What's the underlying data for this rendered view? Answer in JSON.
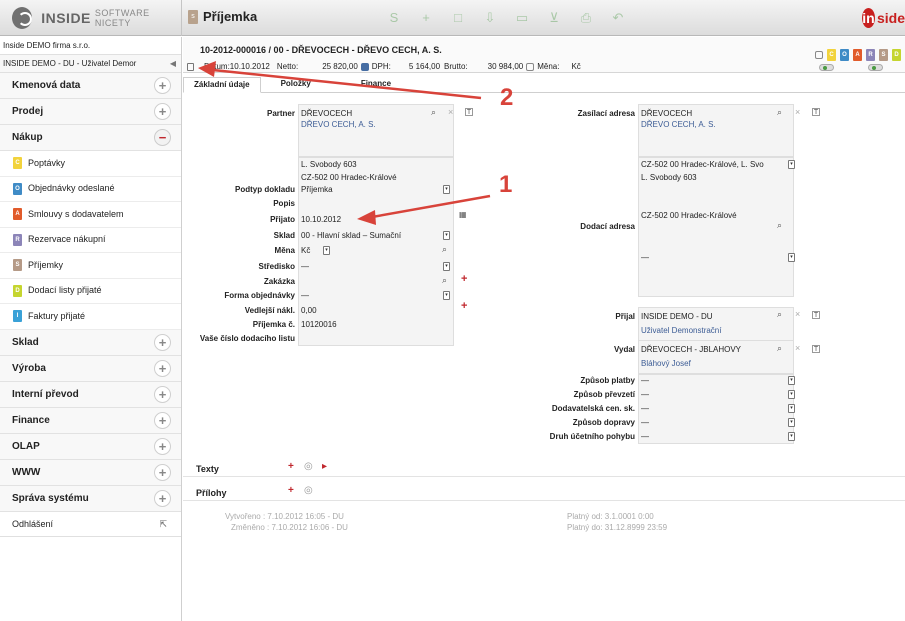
{
  "app": {
    "logo_strong": "INSIDE",
    "logo_light": "SOFTWARE NICETY",
    "brand_text": "side",
    "brand_letter": "in"
  },
  "module": {
    "badge": "s",
    "title": "Příjemka"
  },
  "toolbar": [
    "S",
    "+",
    "□",
    "⇩",
    "▭",
    "⊻",
    "⎙",
    "↶"
  ],
  "sidebar": {
    "firm": "Inside DEMO firma s.r.o.",
    "user": "INSIDE DEMO - DU - Uživatel Demor",
    "groups": [
      {
        "label": "Kmenová data",
        "state": "+"
      },
      {
        "label": "Prodej",
        "state": "+"
      },
      {
        "label": "Nákup",
        "state": "−"
      }
    ],
    "nakup_items": [
      {
        "badge": "C",
        "label": "Poptávky",
        "color": "#f2d33c"
      },
      {
        "badge": "O",
        "label": "Objednávky odeslané",
        "color": "#3f8bc6"
      },
      {
        "badge": "A",
        "label": "Smlouvy s dodavatelem",
        "color": "#e15b2b"
      },
      {
        "badge": "R",
        "label": "Rezervace nákupní",
        "color": "#8c85b8"
      },
      {
        "badge": "S",
        "label": "Příjemky",
        "color": "#b59a87"
      },
      {
        "badge": "D",
        "label": "Dodací listy přijaté",
        "color": "#c5d52f"
      },
      {
        "badge": "I",
        "label": "Faktury přijaté",
        "color": "#3aa1d7"
      }
    ],
    "groups_after": [
      {
        "label": "Sklad",
        "state": "+"
      },
      {
        "label": "Výroba",
        "state": "+"
      },
      {
        "label": "Interní převod",
        "state": "+"
      },
      {
        "label": "Finance",
        "state": "+"
      },
      {
        "label": "OLAP",
        "state": "+"
      },
      {
        "label": "WWW",
        "state": "+"
      },
      {
        "label": "Správa systému",
        "state": "+"
      }
    ],
    "logout": "Odhlášení"
  },
  "document": {
    "number": "10-2012-000016 / 00 - DŘEVOCECH - DŘEVO CECH, A. S.",
    "datum_label": "Datum:",
    "datum": "10.10.2012",
    "netto_label": "Netto:",
    "netto": "25 820,00",
    "dph_label": "DPH:",
    "dph": "5 164,00",
    "brutto_label": "Brutto:",
    "brutto": "30 984,00",
    "mena_label": "Měna:",
    "mena": "Kč"
  },
  "status_icons": [
    {
      "badge": "C",
      "color": "#f2d33c"
    },
    {
      "badge": "O",
      "color": "#3f8bc6"
    },
    {
      "badge": "A",
      "color": "#e15b2b"
    },
    {
      "badge": "R",
      "color": "#8c85b8"
    },
    {
      "badge": "S",
      "color": "#b59a87"
    },
    {
      "badge": "D",
      "color": "#c5d52f"
    }
  ],
  "tabs": [
    "Základní údaje",
    "Položky",
    "Finance"
  ],
  "form": {
    "partner_label": "Partner",
    "partner_code": "DŘEVOCECH",
    "partner_name": "DŘEVO CECH, A. S.",
    "partner_street": "L. Svobody 603",
    "partner_city": "CZ-502 00 Hradec-Králové",
    "podtyp_label": "Podtyp dokladu",
    "podtyp": "Příjemka",
    "popis_label": "Popis",
    "prijato_label": "Přijato",
    "prijato": "10.10.2012",
    "sklad_label": "Sklad",
    "sklad": "00 - Hlavní sklad – Sumační",
    "mena_label": "Měna",
    "mena": "Kč",
    "stredisko_label": "Středisko",
    "stredisko": "—",
    "zakazka_label": "Zakázka",
    "forma_label": "Forma objednávky",
    "forma": "—",
    "vedlejsi_label": "Vedlejší nákl.",
    "vedlejsi": "0,00",
    "prijemka_label": "Příjemka č.",
    "prijemka": "10120016",
    "dodaci_label": "Vaše číslo dodacího listu",
    "zasilaci_label": "Zasílací adresa",
    "zasilaci_code": "DŘEVOCECH",
    "zasilaci_name": "DŘEVO CECH, A. S.",
    "zasilaci_city_select": "CZ-502 00 Hradec-Králové, L. Svo",
    "zasilaci_street": "L. Svobody 603",
    "zasilaci_city": "CZ-502 00 Hradec-Králové",
    "dodaci_adresa_label": "Dodací adresa",
    "dodaci_adresa": "—",
    "prijal_label": "Přijal",
    "prijal": "INSIDE DEMO - DU",
    "prijal_name": "Uživatel Demonstrační",
    "vydal_label": "Vydal",
    "vydal": "DŘEVOCECH - JBLAHOVY",
    "vydal_name": "Bláhový Josef",
    "platba_label": "Způsob platby",
    "platba": "—",
    "prevzeti_label": "Způsob převzetí",
    "prevzeti": "—",
    "cen_label": "Dodavatelská cen. sk.",
    "cen": "—",
    "doprava_label": "Způsob dopravy",
    "doprava": "—",
    "druh_label": "Druh účetního pohybu",
    "druh": "—"
  },
  "sections": {
    "texty": "Texty",
    "prilohy": "Přílohy"
  },
  "audit": {
    "vytvoreno": "Vytvořeno : 7.10.2012 16:05 - DU",
    "zmeneno": "Změněno : 7.10.2012 16:06 - DU",
    "platny_od": "Platný od: 3.1.0001 0:00",
    "platny_do": "Platný do: 31.12.8999 23:59"
  },
  "annotations": {
    "one": "1",
    "two": "2"
  }
}
